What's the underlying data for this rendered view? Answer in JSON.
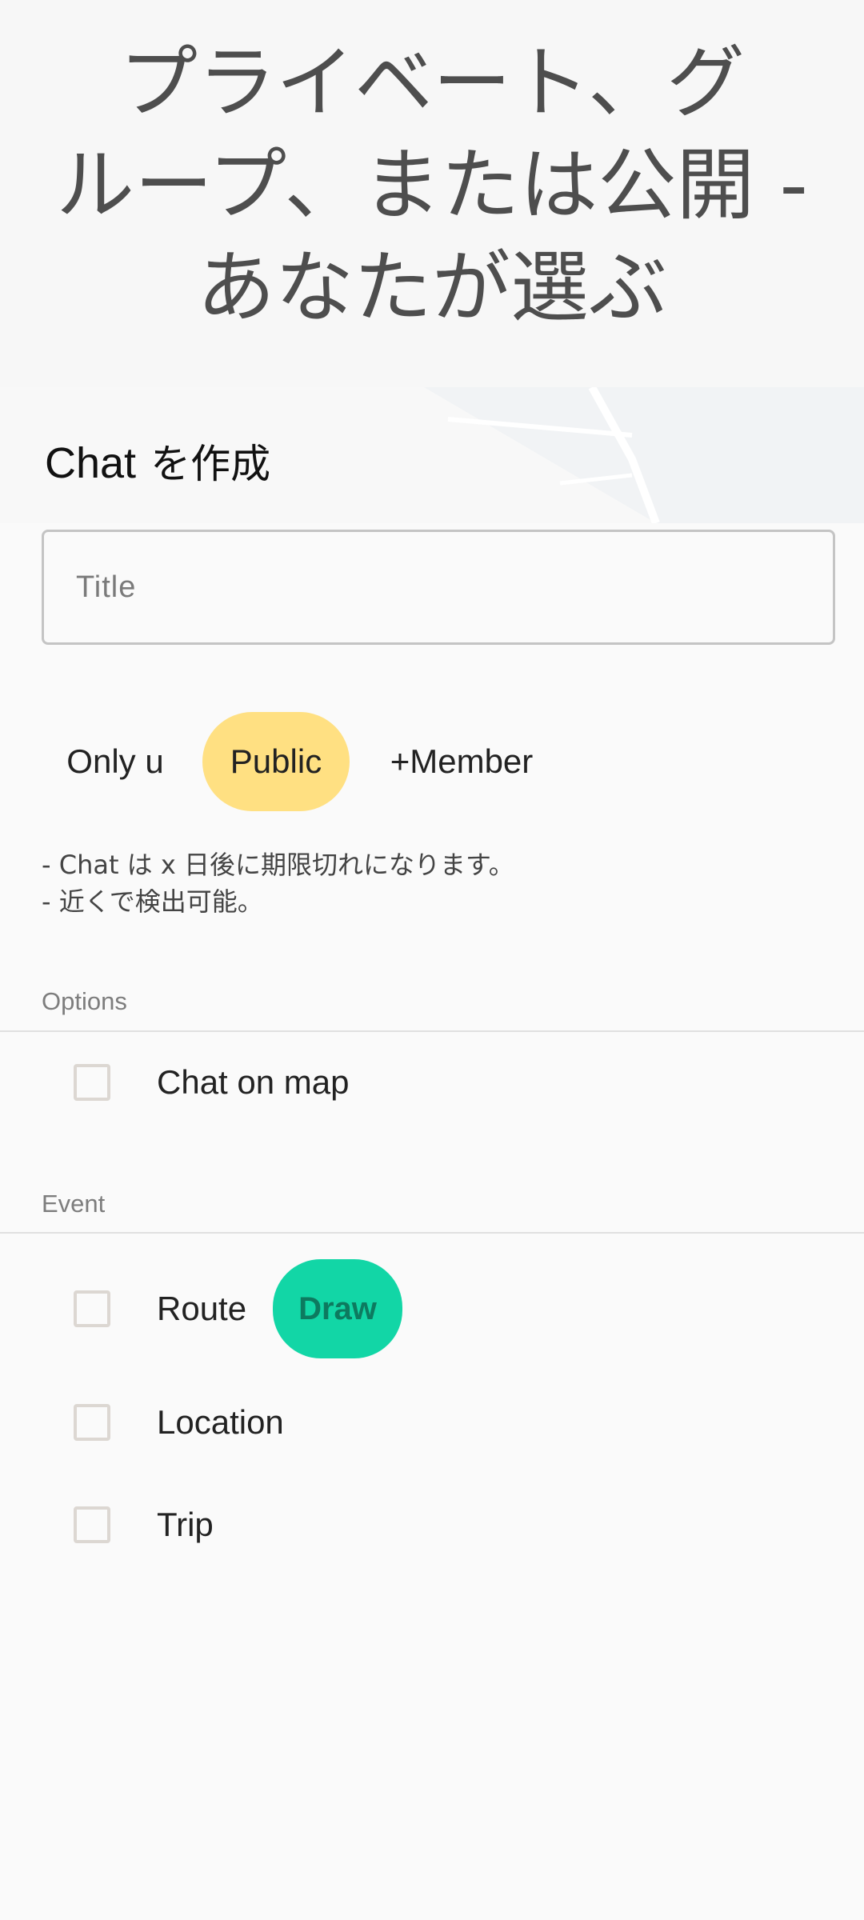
{
  "hero": {
    "title_line1": "プライベート、グ",
    "title_line2": "ループ、または公開 -",
    "title_line3": "あなたが選ぶ"
  },
  "create": {
    "heading_chat": "Chat",
    "heading_suffix": "を作成",
    "title_placeholder": "Title"
  },
  "visibility": {
    "options": [
      "Only u",
      "Public",
      "+Member"
    ],
    "selected": "Public",
    "selected_color": "#ffe082"
  },
  "info": {
    "line1": "- Chat は x 日後に期限切れになります。",
    "line2": "- 近くで検出可能。"
  },
  "options_section": {
    "label": "Options",
    "items": [
      {
        "label": "Chat on map",
        "checked": false
      }
    ]
  },
  "event_section": {
    "label": "Event",
    "items": [
      {
        "label": "Route",
        "checked": false
      },
      {
        "label": "Location",
        "checked": false
      },
      {
        "label": "Trip",
        "checked": false
      }
    ],
    "draw_label": "Draw",
    "draw_color": "#12d6a6"
  },
  "icons": {
    "checkbox": "checkbox-unchecked-icon"
  }
}
